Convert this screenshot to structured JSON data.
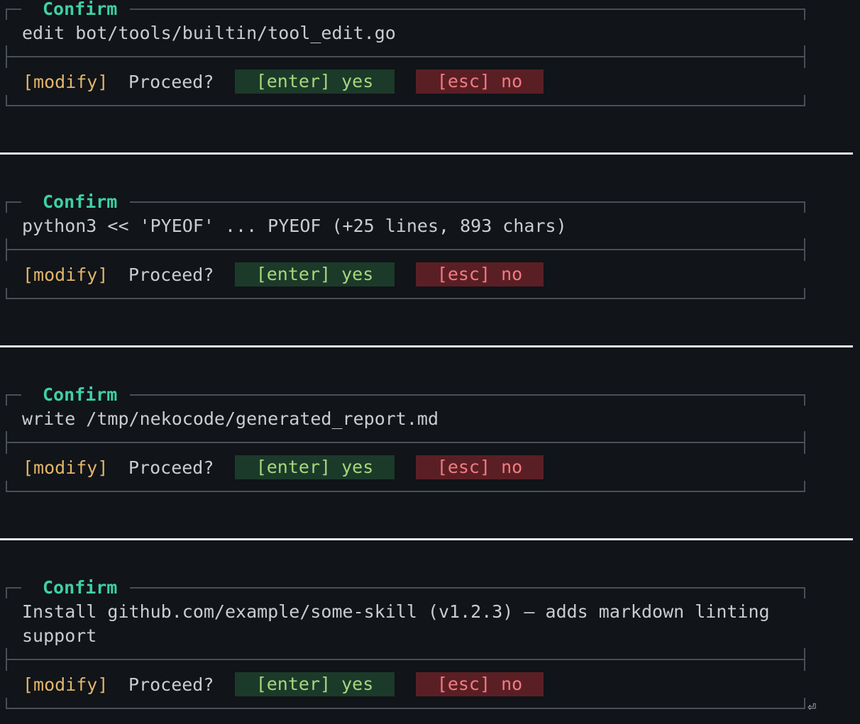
{
  "confirm_dialogs": [
    {
      "title": "Confirm",
      "description": "edit bot/tools/builtin/tool_edit.go",
      "tag": "[modify]",
      "prompt": "Proceed?",
      "yes_label": "[enter] yes",
      "no_label": "[esc] no"
    },
    {
      "title": "Confirm",
      "description": "python3 << 'PYEOF' ... PYEOF (+25 lines, 893 chars)",
      "tag": "[modify]",
      "prompt": "Proceed?",
      "yes_label": "[enter] yes",
      "no_label": "[esc] no"
    },
    {
      "title": "Confirm",
      "description": "write /tmp/nekocode/generated_report.md",
      "tag": "[modify]",
      "prompt": "Proceed?",
      "yes_label": "[enter] yes",
      "no_label": "[esc] no"
    },
    {
      "title": "Confirm",
      "description": "Install github.com/example/some-skill (v1.2.3) — adds markdown linting\nsupport",
      "tag": "[modify]",
      "prompt": "Proceed?",
      "yes_label": "[enter] yes",
      "no_label": "[esc] no"
    }
  ],
  "footer": {
    "enter_icon": "⏎"
  },
  "colors": {
    "background": "#111418",
    "title": "#3ed0a6",
    "tag": "#e1b56b",
    "yes_bg": "#1c3a2a",
    "yes_fg": "#a6d77c",
    "no_bg": "#5a1f24",
    "no_fg": "#ef7c82",
    "border": "#4a4f57",
    "separator": "#e8eaec"
  }
}
